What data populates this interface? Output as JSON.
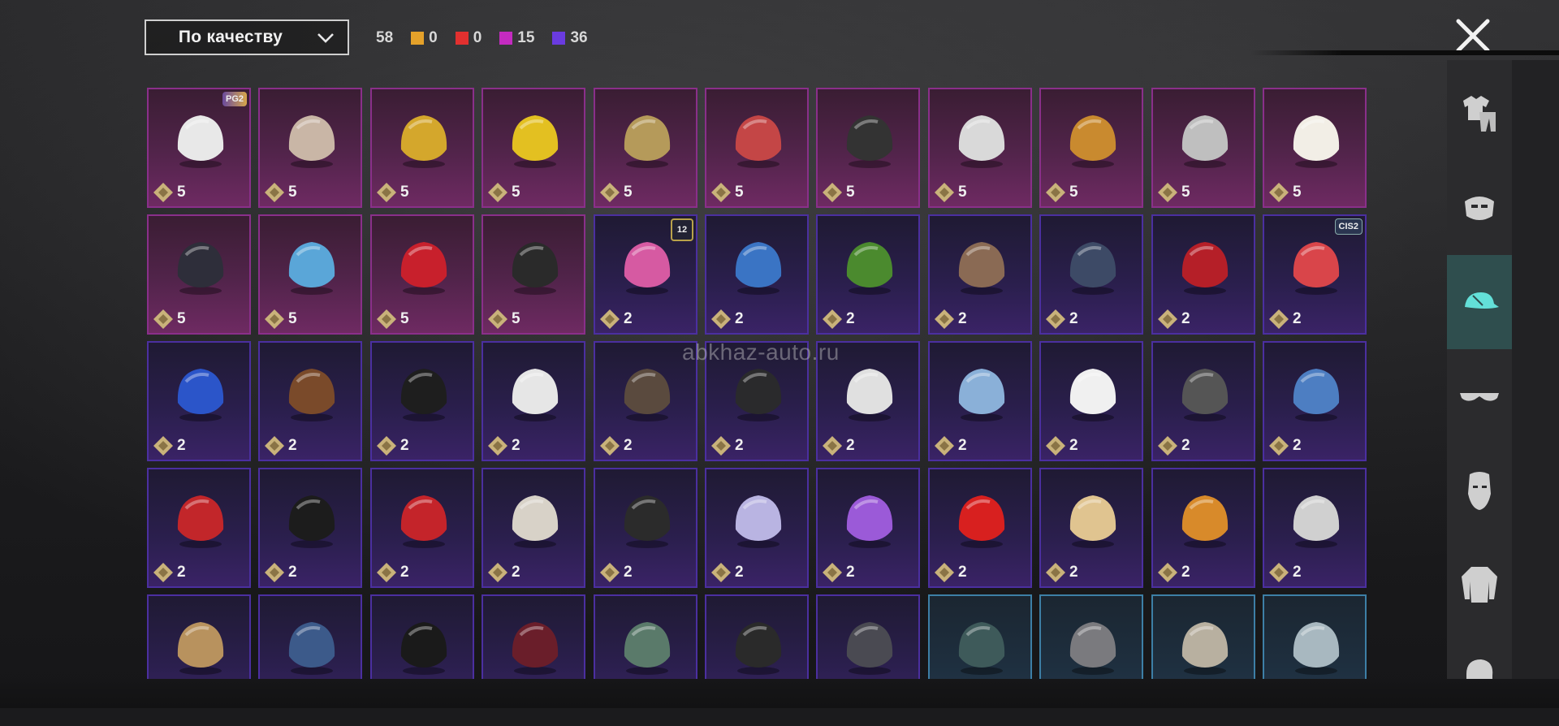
{
  "sort": {
    "label": "По качеству",
    "icon": "chevron-down-icon"
  },
  "counts": {
    "total": "58",
    "stats": [
      {
        "color": "#e4a12a",
        "value": "0"
      },
      {
        "color": "#e2302f",
        "value": "0"
      },
      {
        "color": "#c42bc0",
        "value": "15"
      },
      {
        "color": "#6a3be0",
        "value": "36"
      }
    ]
  },
  "close_icon": "close-icon",
  "watermark": "abkhaz-auto.ru",
  "categories": [
    {
      "name": "outfit",
      "icon": "outfit-icon",
      "active": false
    },
    {
      "name": "mask",
      "icon": "mask-icon",
      "active": false
    },
    {
      "name": "headwear",
      "icon": "cap-icon",
      "active": true
    },
    {
      "name": "glasses",
      "icon": "glasses-icon",
      "active": false
    },
    {
      "name": "face",
      "icon": "face-icon",
      "active": false
    },
    {
      "name": "jacket",
      "icon": "jacket-icon",
      "active": false
    },
    {
      "name": "hair",
      "icon": "hair-icon",
      "active": false
    }
  ],
  "colors": {
    "tier5": "#8a2f8a",
    "tier2": "#4b2fa0",
    "tier1": "#3d7fa6",
    "coin": "#c9b27a",
    "active_tab": "#2f4e4e"
  },
  "items": [
    {
      "name": "panda-mask",
      "tier": "t5",
      "price": "5",
      "badge": "PG2",
      "color": "#e8e8e8"
    },
    {
      "name": "beast-mask",
      "tier": "t5",
      "price": "5",
      "color": "#c9b6a6"
    },
    {
      "name": "golden-crown-mask",
      "tier": "t5",
      "price": "5",
      "color": "#d4a72c"
    },
    {
      "name": "duck-helmet",
      "tier": "t5",
      "price": "5",
      "color": "#e3c021"
    },
    {
      "name": "skull-viking-helmet",
      "tier": "t5",
      "price": "5",
      "color": "#b59a5a"
    },
    {
      "name": "ornate-helmet",
      "tier": "t5",
      "price": "5",
      "color": "#c44646"
    },
    {
      "name": "kendo-helmet",
      "tier": "t5",
      "price": "5",
      "color": "#333333"
    },
    {
      "name": "lion-dreadlocks",
      "tier": "t5",
      "price": "5",
      "color": "#d9d9d9"
    },
    {
      "name": "golden-beast-helmet",
      "tier": "t5",
      "price": "5",
      "color": "#c98a2f"
    },
    {
      "name": "skull-dread-mask",
      "tier": "t5",
      "price": "5",
      "color": "#bfbfbf"
    },
    {
      "name": "sheep-mask",
      "tier": "t5",
      "price": "5",
      "color": "#f2eee6"
    },
    {
      "name": "cyber-helmet",
      "tier": "t5",
      "price": "5",
      "color": "#2e2e3a"
    },
    {
      "name": "blue-dragon-mask",
      "tier": "t5",
      "price": "5",
      "color": "#5aa6d8"
    },
    {
      "name": "devil-horns",
      "tier": "t5",
      "price": "5",
      "color": "#c8202c"
    },
    {
      "name": "skull-balaclava",
      "tier": "t5",
      "price": "5",
      "color": "#2a2a2a"
    },
    {
      "name": "bunny-helmet",
      "tier": "t2",
      "price": "2",
      "badge": "12",
      "color": "#d65aa2"
    },
    {
      "name": "globe-cap",
      "tier": "t2",
      "price": "2",
      "color": "#3a74c4"
    },
    {
      "name": "gas-mask-helmet",
      "tier": "t2",
      "price": "2",
      "color": "#4b8a2e"
    },
    {
      "name": "horned-helmet",
      "tier": "t2",
      "price": "2",
      "color": "#8a6a54"
    },
    {
      "name": "navy-beanie",
      "tier": "t2",
      "price": "2",
      "color": "#3d4a66"
    },
    {
      "name": "bucket-hat-red-hair",
      "tier": "t2",
      "price": "2",
      "color": "#b51f28"
    },
    {
      "name": "flag-beanie",
      "tier": "t2",
      "price": "2",
      "badge": "CIS2",
      "color": "#d9454a"
    },
    {
      "name": "cricket-helmet",
      "tier": "t2",
      "price": "2",
      "color": "#2b55c9"
    },
    {
      "name": "aviator-cap-brown",
      "tier": "t2",
      "price": "2",
      "color": "#7a4a2a"
    },
    {
      "name": "black-fedora",
      "tier": "t2",
      "price": "2",
      "color": "#1e1e1e"
    },
    {
      "name": "white-turban",
      "tier": "t2",
      "price": "2",
      "color": "#e6e6e6"
    },
    {
      "name": "pilot-cap",
      "tier": "t2",
      "price": "2",
      "color": "#5a4a3e"
    },
    {
      "name": "black-cap",
      "tier": "t2",
      "price": "2",
      "color": "#2a2a2c"
    },
    {
      "name": "cat-headphones",
      "tier": "t2",
      "price": "2",
      "color": "#e0e0e0"
    },
    {
      "name": "pompom-beanie",
      "tier": "t2",
      "price": "2",
      "color": "#8ab0d8"
    },
    {
      "name": "feather-hat",
      "tier": "t2",
      "price": "2",
      "color": "#f0f0f0"
    },
    {
      "name": "luchador-mask",
      "tier": "t2",
      "price": "2",
      "color": "#555555"
    },
    {
      "name": "shark-hood",
      "tier": "t2",
      "price": "2",
      "color": "#4d7ec2"
    },
    {
      "name": "red-beret",
      "tier": "t2",
      "price": "2",
      "color": "#c2262a"
    },
    {
      "name": "black-top-hat",
      "tier": "t2",
      "price": "2",
      "color": "#1c1c1c"
    },
    {
      "name": "red-fedora",
      "tier": "t2",
      "price": "2",
      "color": "#c4242a"
    },
    {
      "name": "shark-mask",
      "tier": "t2",
      "price": "2",
      "color": "#d8d2c8"
    },
    {
      "name": "black-helmet",
      "tier": "t2",
      "price": "2",
      "color": "#2b2b2b"
    },
    {
      "name": "lilac-bike-helmet",
      "tier": "t2",
      "price": "2",
      "color": "#b9b4e2"
    },
    {
      "name": "flower-crown",
      "tier": "t2",
      "price": "2",
      "color": "#9b5ad8"
    },
    {
      "name": "red-bucket-hat",
      "tier": "t2",
      "price": "2",
      "color": "#d8201f"
    },
    {
      "name": "cake-hat",
      "tier": "t2",
      "price": "2",
      "color": "#e0c490"
    },
    {
      "name": "burger-hat",
      "tier": "t2",
      "price": "2",
      "color": "#d88a2a"
    },
    {
      "name": "head-mirror",
      "tier": "t2",
      "price": "2",
      "color": "#d0d0d0"
    },
    {
      "name": "cardboard-box",
      "tier": "t2",
      "price": "",
      "color": "#b8925e"
    },
    {
      "name": "blue-cap-round",
      "tier": "t2",
      "price": "",
      "color": "#3c5a8a"
    },
    {
      "name": "black-yellow-cap",
      "tier": "t2",
      "price": "",
      "color": "#1a1a1a"
    },
    {
      "name": "maroon-fedora",
      "tier": "t2",
      "price": "",
      "color": "#6a1e2a"
    },
    {
      "name": "net-helmet",
      "tier": "t2",
      "price": "",
      "color": "#5a7a6a"
    },
    {
      "name": "black-bucket-hat",
      "tier": "t2",
      "price": "",
      "color": "#2a2a2a"
    },
    {
      "name": "goggle-cap",
      "tier": "t2",
      "price": "",
      "color": "#4a4a52"
    },
    {
      "name": "teal-beret",
      "tier": "t1",
      "price": "",
      "color": "#3e5a5a"
    },
    {
      "name": "grey-flat-cap",
      "tier": "t1",
      "price": "",
      "color": "#7a7a7e"
    },
    {
      "name": "trucker-cap-a",
      "tier": "t1",
      "price": "",
      "color": "#b8b0a0"
    },
    {
      "name": "trucker-cap-b",
      "tier": "t1",
      "price": "",
      "color": "#a8b8c0"
    }
  ]
}
